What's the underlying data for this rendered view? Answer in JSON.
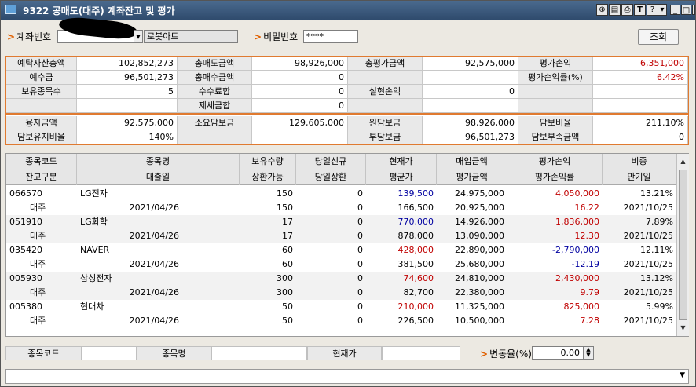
{
  "window": {
    "title": "9322 공매도(대주) 계좌잔고 및 평가",
    "toolbar_icons": [
      "pin-icon",
      "clipboard-icon",
      "print-icon",
      "text-icon",
      "help-icon",
      "dropdown-icon"
    ],
    "window_buttons": [
      "minimize-icon",
      "maximize-icon",
      "close-icon"
    ]
  },
  "header": {
    "account_label": "계좌번호",
    "account_type": "로봇아트",
    "password_label": "비밀번호",
    "password_value": "****",
    "query_button": "조회"
  },
  "summary": {
    "deposit_assets_label": "예탁자산총액",
    "deposit_assets": "102,852,273",
    "short_sell_amount_label": "총매도금액",
    "short_sell_amount": "98,926,000",
    "total_eval_label": "총평가금액",
    "total_eval": "92,575,000",
    "eval_pl_label": "평가손익",
    "eval_pl": "6,351,000",
    "deposit_label": "예수금",
    "deposit": "96,501,273",
    "short_buy_amount_label": "총매수금액",
    "short_buy_amount": "0",
    "eval_pl_rate_label": "평가손익률(%)",
    "eval_pl_rate": "6.42%",
    "holdings_count_label": "보유종목수",
    "holdings_count": "5",
    "fee_sum_label": "수수료합",
    "fee_sum": "0",
    "realized_pl_label": "실현손익",
    "realized_pl": "0",
    "tax_sum_label": "제세금합",
    "tax_sum": "0",
    "loan_amount_label": "융자금액",
    "loan_amount": "92,575,000",
    "required_collateral_label": "소요담보금",
    "required_collateral": "129,605,000",
    "principal_collateral_label": "원담보금",
    "principal_collateral": "98,926,000",
    "collateral_ratio_label": "담보비율",
    "collateral_ratio": "211.10%",
    "maint_ratio_label": "담보유지비율",
    "maint_ratio": "140%",
    "additional_collateral_label": "부담보금",
    "additional_collateral": "96,501,273",
    "collateral_shortfall_label": "담보부족금액",
    "collateral_shortfall": "0"
  },
  "table": {
    "headers_top": [
      "종목코드",
      "종목명",
      "보유수량",
      "당일신규",
      "현재가",
      "매입금액",
      "평가손익",
      "비중"
    ],
    "headers_bottom": [
      "잔고구분",
      "대출일",
      "상환가능",
      "당일상환",
      "평균가",
      "평가금액",
      "평가손익률",
      "만기일"
    ],
    "rows": [
      {
        "code": "066570",
        "name": "LG전자",
        "qty": "150",
        "today_new": "0",
        "price": "139,500",
        "buy_amt": "24,975,000",
        "pl": "4,050,000",
        "weight": "13.21%",
        "type": "대주",
        "loan_date": "2021/04/26",
        "repayable": "150",
        "today_repay": "0",
        "avg": "166,500",
        "eval_amt": "20,925,000",
        "pl_rate": "16.22",
        "expiry": "2021/10/25",
        "price_color": "#0000a0",
        "pl_color": "#c00000"
      },
      {
        "code": "051910",
        "name": "LG화학",
        "qty": "17",
        "today_new": "0",
        "price": "770,000",
        "buy_amt": "14,926,000",
        "pl": "1,836,000",
        "weight": "7.89%",
        "type": "대주",
        "loan_date": "2021/04/26",
        "repayable": "17",
        "today_repay": "0",
        "avg": "878,000",
        "eval_amt": "13,090,000",
        "pl_rate": "12.30",
        "expiry": "2021/10/25",
        "price_color": "#0000a0",
        "pl_color": "#c00000"
      },
      {
        "code": "035420",
        "name": "NAVER",
        "qty": "60",
        "today_new": "0",
        "price": "428,000",
        "buy_amt": "22,890,000",
        "pl": "-2,790,000",
        "weight": "12.11%",
        "type": "대주",
        "loan_date": "2021/04/26",
        "repayable": "60",
        "today_repay": "0",
        "avg": "381,500",
        "eval_amt": "25,680,000",
        "pl_rate": "-12.19",
        "expiry": "2021/10/25",
        "price_color": "#c00000",
        "pl_color": "#0000a0"
      },
      {
        "code": "005930",
        "name": "삼성전자",
        "qty": "300",
        "today_new": "0",
        "price": "74,600",
        "buy_amt": "24,810,000",
        "pl": "2,430,000",
        "weight": "13.12%",
        "type": "대주",
        "loan_date": "2021/04/26",
        "repayable": "300",
        "today_repay": "0",
        "avg": "82,700",
        "eval_amt": "22,380,000",
        "pl_rate": "9.79",
        "expiry": "2021/10/25",
        "price_color": "#c00000",
        "pl_color": "#c00000"
      },
      {
        "code": "005380",
        "name": "현대차",
        "qty": "50",
        "today_new": "0",
        "price": "210,000",
        "buy_amt": "11,325,000",
        "pl": "825,000",
        "weight": "5.99%",
        "type": "대주",
        "loan_date": "2021/04/26",
        "repayable": "50",
        "today_repay": "0",
        "avg": "226,500",
        "eval_amt": "10,500,000",
        "pl_rate": "7.28",
        "expiry": "2021/10/25",
        "price_color": "#c00000",
        "pl_color": "#c00000"
      }
    ]
  },
  "bottom": {
    "code_label": "종목코드",
    "name_label": "종목명",
    "price_label": "현재가",
    "change_label": "변동율(%)",
    "change_value": "0.00"
  }
}
